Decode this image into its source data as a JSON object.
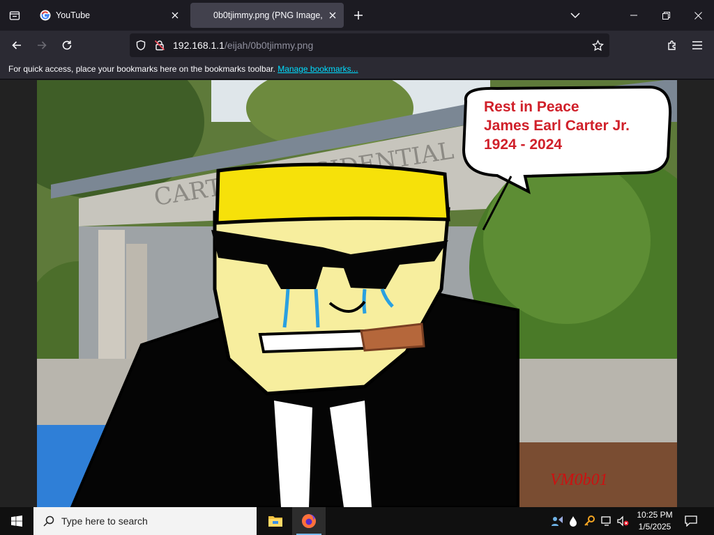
{
  "browser": {
    "tabs": [
      {
        "title": "YouTube",
        "active": false,
        "icon": "google-icon"
      },
      {
        "title": "0b0tjimmy.png (PNG Image, 91",
        "active": true,
        "icon": "image-icon"
      }
    ],
    "url": {
      "host": "192.168.1.1",
      "path": "/eijah/0b0tjimmy.png"
    },
    "bookmarks_bar": {
      "message": "For quick access, place your bookmarks here on the bookmarks toolbar.",
      "link": "Manage bookmarks..."
    }
  },
  "image": {
    "caption_lines": [
      "Rest in Peace",
      "James Earl Carter Jr.",
      "1924 - 2024"
    ],
    "building_text": "CARTER PRESIDENTIAL",
    "signature": "VM0b01",
    "colors": {
      "caption": "#d0202a",
      "signature": "#cc1111",
      "hair": "#f6e10a",
      "skin": "#f7ee9e"
    }
  },
  "taskbar": {
    "search_placeholder": "Type here to search",
    "time": "10:25 PM",
    "date": "1/5/2025"
  }
}
